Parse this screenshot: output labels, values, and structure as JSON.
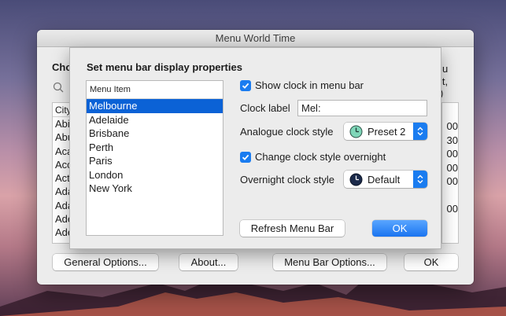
{
  "main_window": {
    "title": "Menu World Time",
    "heading_partial": "Cho",
    "right_text": [
      "u",
      "it,",
      ")"
    ],
    "list_header_partial": "City",
    "list_rows_partial": [
      "Abi",
      "Abu",
      "Aca",
      "Acc",
      "Act",
      "Ada",
      "Ada",
      "Ade",
      "Ade"
    ],
    "right_column_partial": [
      "00",
      "30",
      "00",
      "00",
      "00",
      "00"
    ],
    "buttons": {
      "general_options": "General Options...",
      "about": "About...",
      "menu_bar_options": "Menu Bar Options...",
      "ok": "OK"
    }
  },
  "sheet": {
    "title": "Set menu bar display properties",
    "list_header": "Menu Item",
    "menu_items": [
      "Melbourne",
      "Adelaide",
      "Brisbane",
      "Perth",
      "Paris",
      "London",
      "New York"
    ],
    "selected_item": "Melbourne",
    "show_clock_label": "Show clock in menu bar",
    "show_clock_checked": true,
    "clock_label_caption": "Clock label",
    "clock_label_value": "Mel:",
    "analogue_style_caption": "Analogue clock style",
    "analogue_style_value": "Preset 2",
    "change_overnight_label": "Change clock style overnight",
    "change_overnight_checked": true,
    "overnight_style_caption": "Overnight clock style",
    "overnight_style_value": "Default",
    "refresh_button": "Refresh Menu Bar",
    "ok_button": "OK"
  },
  "colors": {
    "accent": "#1a7cf0",
    "selection": "#0b62d6",
    "preset2_clock_face": "#7fd6b8",
    "default_clock_face": "#1b2a4a"
  },
  "icons": {
    "search": "search-icon",
    "analogue_clock": "clock-preset2-icon",
    "overnight_clock": "clock-default-icon",
    "popup_arrows": "up-down-arrows-icon",
    "checkmark": "checkmark-icon"
  }
}
